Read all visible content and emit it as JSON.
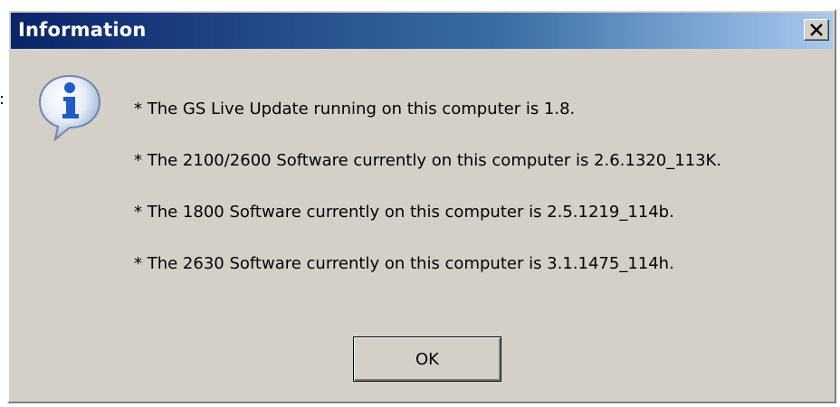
{
  "window": {
    "title": "Information",
    "close_icon": "close-icon"
  },
  "icon": {
    "name": "information-icon",
    "glyph": "i",
    "color": "#2060c0"
  },
  "messages": [
    "* The GS Live Update running on this computer is 1.8.",
    "* The 2100/2600 Software currently on this computer is 2.6.1320_113K.",
    "* The 1800 Software currently on this computer is 2.5.1219_114b.",
    "* The 2630 Software currently on this computer is 3.1.1475_114h."
  ],
  "buttons": {
    "ok_label": "OK"
  },
  "colors": {
    "dialog_face": "#d4d0c8",
    "title_bar_start": "#0a246a",
    "title_bar_end": "#a6caf0"
  }
}
